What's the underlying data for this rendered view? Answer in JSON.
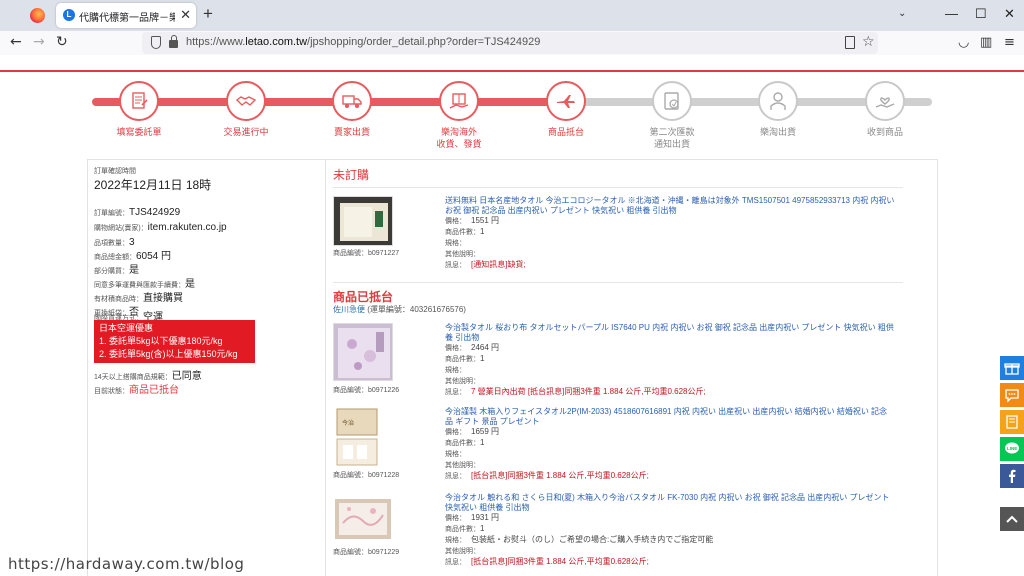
{
  "browser": {
    "tab_title": "代購代標第一品牌－樂淘letao",
    "tab_favicon": "letao-favicon",
    "url_prefix": "https://www.",
    "url_host": "letao.com.tw",
    "url_path": "/jpshopping/order_detail.php?order=TJS424929"
  },
  "steps": [
    {
      "label": "填寫委託單",
      "state": "done",
      "icon": "form-icon"
    },
    {
      "label": "交易進行中",
      "state": "done",
      "icon": "handshake-icon"
    },
    {
      "label": "賣家出貨",
      "state": "done",
      "icon": "truck-icon"
    },
    {
      "label": "樂淘海外\n收貨、發貨",
      "state": "done",
      "icon": "package-icon"
    },
    {
      "label": "商品抵台",
      "state": "done",
      "icon": "airplane-icon"
    },
    {
      "label": "第二次匯款\n通知出貨",
      "state": "todo",
      "icon": "payment-icon"
    },
    {
      "label": "樂淘出貨",
      "state": "todo",
      "icon": "courier-icon"
    },
    {
      "label": "收到商品",
      "state": "todo",
      "icon": "receive-icon"
    }
  ],
  "order": {
    "confirm_time_label": "訂單確認時間",
    "confirm_time": "2022年12月11日 18時",
    "order_no_label": "訂單編號：",
    "order_no": "TJS424929",
    "site_label": "購物網站(賣家)：",
    "site": "item.rakuten.co.jp",
    "qty_label": "品項數量：",
    "qty": "3",
    "total_label": "商品總金額：",
    "total": "6054 円",
    "partial_label": "部分購買：",
    "partial": "是",
    "multi_fee_label": "同意多筆運費與匯款手續費：",
    "multi_fee": "是",
    "restock_label": "有材積商品時：",
    "restock": "直接購買",
    "swap_label": "更換紙袋：",
    "swap": "否",
    "shipping_label": "國際貨運方式：",
    "shipping": "空運",
    "promo_lines": [
      "日本空運優惠",
      "1. 委託單5kg以下優惠180元/kg",
      "2. 委託單5kg(含)以上優惠150元/kg"
    ],
    "merge_label": "14天以上搭購商品規範：",
    "merge": "已同意",
    "status_label": "目前狀態：",
    "status": "商品已抵台"
  },
  "sections": {
    "not_ordered_title": "未訂購",
    "arrived_title": "商品已抵台",
    "carrier": "佐川急便",
    "tracking_label": "(運單編號：",
    "tracking_no": "403261676576)"
  },
  "labels": {
    "price": "價格：",
    "count": "商品件數：",
    "spec": "規格：",
    "note": "其他說明：",
    "message": "訊息："
  },
  "items": [
    {
      "name": "送料無料 日本名産地タオル 今治エコロジータオル ※北海道・沖縄・離島は対象外 TMS1507501 4975852933713 内祝 内祝い お祝 御祝 記念品 出産内祝い プレゼント 快気祝い 粗供養 引出物",
      "price": "1551 円",
      "count": "1",
      "spec": "",
      "note": "",
      "message": "[通知訊息]缺貨;",
      "code": "商品編號：b0971227"
    },
    {
      "name": "今治製タオル 桜おり布 タオルセットパープル IS7640 PU 内祝 内祝い お祝 御祝 記念品 出産内祝い プレゼント 快気祝い 粗供養 引出物",
      "price": "2464 円",
      "count": "1",
      "spec": "",
      "note": "",
      "message": "7 營業日內出荷  [抵台訊息]同捆3件重 1.884 公斤,平均重0.628公斤;",
      "code": "商品編號：b0971226"
    },
    {
      "name": "今治謹製 木箱入りフェイスタオル2P(IM-2033) 4518607616891 内祝 内祝い 出産祝い 出産内祝い 結婚内祝い 結婚祝い 記念品 ギフト 景品 プレゼント",
      "price": "1659 円",
      "count": "1",
      "spec": "",
      "note": "",
      "message": "[抵台訊息]同捆3件重 1.884 公斤,平均重0.628公斤;",
      "code": "商品編號：b0971228"
    },
    {
      "name": "今治タオル 触れる和 さくら日和(夏) 木箱入り今治バスタオル FK-7030 内祝 内祝い お祝 御祝 記念品 出産内祝い プレゼント 快気祝い 粗供養 引出物",
      "price": "1931 円",
      "count": "1",
      "spec": "包装紙・お熨斗（のし）ご希望の場合:ご購入手続き内でご指定可能",
      "note": "",
      "message": "[抵台訊息]同捆3件重 1.884 公斤,平均重0.628公斤;",
      "code": "商品編號：b0971229"
    }
  ],
  "float_buttons": [
    {
      "icon": "gift-icon",
      "color": "#1f7fe0"
    },
    {
      "icon": "chat-icon",
      "color": "#f08a18"
    },
    {
      "icon": "book-icon",
      "color": "#f4a21a"
    },
    {
      "icon": "line-icon",
      "color": "#06c755"
    },
    {
      "icon": "facebook-icon",
      "color": "#3b5998"
    },
    {
      "icon": "back-to-top-icon",
      "color": "#555555"
    }
  ],
  "watermark": "https://hardaway.com.tw/blog"
}
